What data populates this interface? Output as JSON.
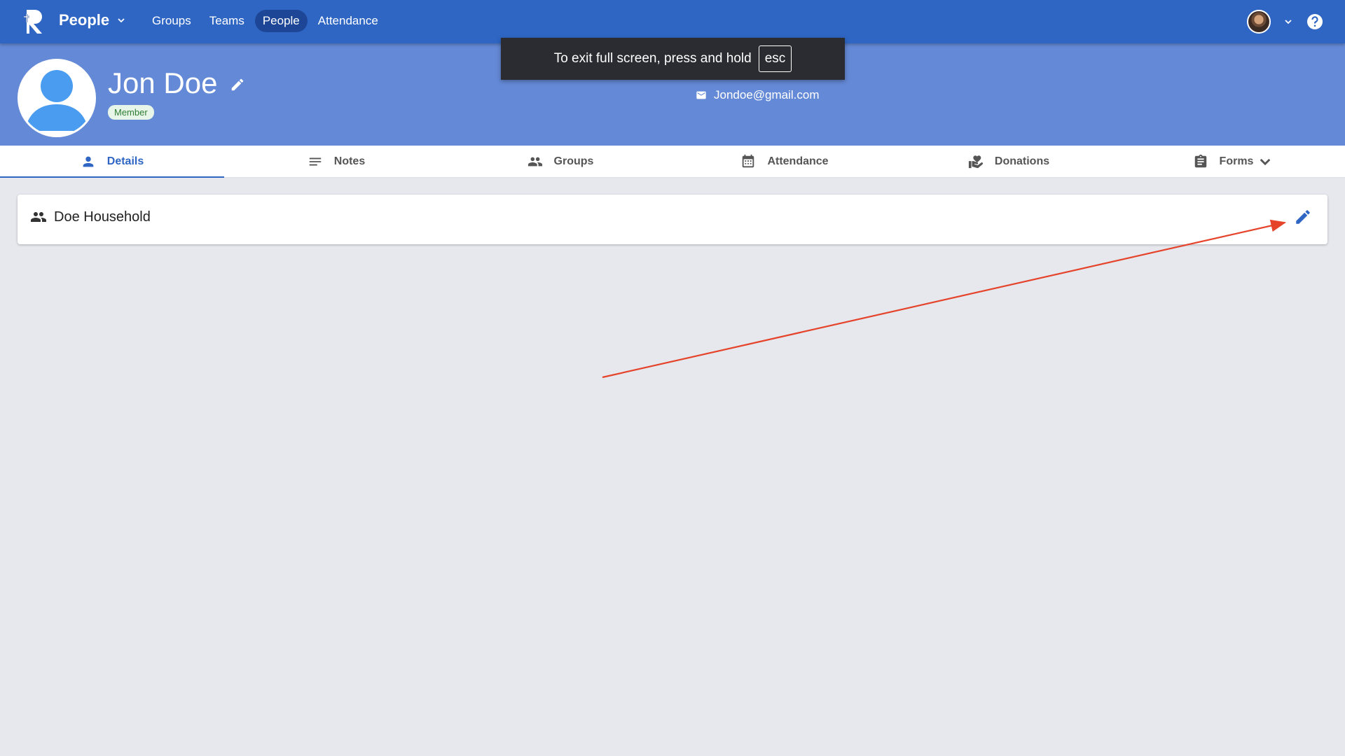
{
  "topbar": {
    "app_name": "People",
    "nav": [
      "Groups",
      "Teams",
      "People",
      "Attendance"
    ],
    "active_nav": "People"
  },
  "profile": {
    "name": "Jon Doe",
    "badge": "Member",
    "email": "Jondoe@gmail.com"
  },
  "toast": {
    "text": "To exit full screen, press and hold",
    "key": "esc"
  },
  "tabs": [
    {
      "label": "Details",
      "icon": "person-icon",
      "active": true
    },
    {
      "label": "Notes",
      "icon": "notes-icon",
      "active": false
    },
    {
      "label": "Groups",
      "icon": "groups-icon",
      "active": false
    },
    {
      "label": "Attendance",
      "icon": "calendar-icon",
      "active": false
    },
    {
      "label": "Donations",
      "icon": "donation-icon",
      "active": false
    },
    {
      "label": "Forms",
      "icon": "clipboard-icon",
      "active": false
    }
  ],
  "household": {
    "title": "Doe Household"
  },
  "colors": {
    "primary": "#2f66c4",
    "header": "#6489d6",
    "annotation": "#e5432a"
  }
}
